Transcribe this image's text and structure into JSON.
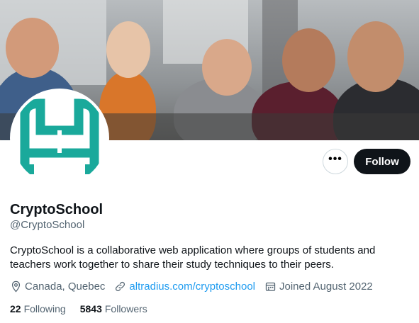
{
  "profile": {
    "name": "CryptoSchool",
    "handle": "@CryptoSchool",
    "bio": "CryptoSchool is a collaborative web application where groups of students and teachers work together to share their study techniques to their peers.",
    "location": "Canada, Quebec",
    "website": "altradius.com/cryptoschool",
    "joined": "Joined August 2022",
    "following_count": "22",
    "following_label": "Following",
    "followers_count": "5843",
    "followers_label": "Followers"
  },
  "actions": {
    "more_label": "•••",
    "follow_label": "Follow"
  },
  "icons": {
    "location": "location-pin-icon",
    "website": "link-icon",
    "joined": "calendar-icon",
    "more": "more-dots-icon"
  },
  "colors": {
    "accent_link": "#1d9bf0",
    "follow_button": "#0f1419",
    "logo_teal": "#1aa99b",
    "secondary_text": "#536471"
  }
}
